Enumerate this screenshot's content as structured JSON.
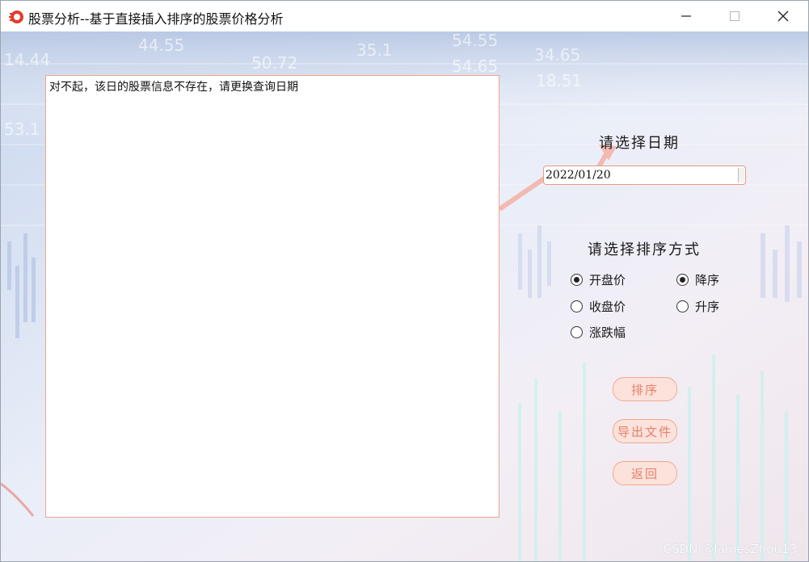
{
  "window": {
    "title": "股票分析--基于直接插入排序的股票价格分析"
  },
  "output": {
    "text": "对不起，该日的股票信息不存在，请更换查询日期"
  },
  "date": {
    "label": "请选择日期",
    "selected": "2022/01/20"
  },
  "sort": {
    "label": "请选择排序方式",
    "fields": [
      {
        "label": "开盘价",
        "checked": true
      },
      {
        "label": "收盘价",
        "checked": false
      },
      {
        "label": "涨跌幅",
        "checked": false
      }
    ],
    "orders": [
      {
        "label": "降序",
        "checked": true
      },
      {
        "label": "升序",
        "checked": false
      }
    ]
  },
  "buttons": {
    "sort": "排序",
    "export": "导出文件",
    "back": "返回"
  },
  "background_numbers": [
    "44.55",
    "54.55",
    "54.65",
    "14.44",
    "35.1",
    "50.72",
    "34.65",
    "18.51",
    "53.1"
  ],
  "watermark": "CSDN @JamesZhou13",
  "colors": {
    "accent": "#f0a58a",
    "button_bg": "#fbe2db",
    "button_text": "#e8806a"
  }
}
